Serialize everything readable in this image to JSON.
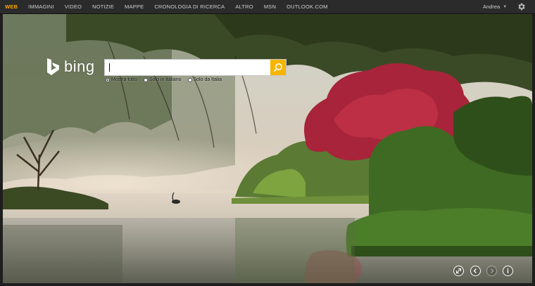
{
  "nav": {
    "items": [
      {
        "label": "WEB",
        "active": true
      },
      {
        "label": "IMMAGINI",
        "active": false
      },
      {
        "label": "VIDEO",
        "active": false
      },
      {
        "label": "NOTIZIE",
        "active": false
      },
      {
        "label": "MAPPE",
        "active": false
      },
      {
        "label": "CRONOLOGIA DI RICERCA",
        "active": false
      },
      {
        "label": "ALTRO",
        "active": false
      },
      {
        "label": "MSN",
        "active": false
      },
      {
        "label": "OUTLOOK.COM",
        "active": false
      }
    ],
    "user_name": "Andrea",
    "settings_icon": "gear-icon"
  },
  "colors": {
    "accent": "#f7a600",
    "topbar": "#2b2b2b",
    "search_button": "#f7b500"
  },
  "logo": {
    "text": "bing",
    "icon": "bing-b-icon"
  },
  "search": {
    "value": "",
    "placeholder": "",
    "button_icon": "search-icon"
  },
  "scopes": [
    {
      "label": "Mostra tutto",
      "checked": true
    },
    {
      "label": "Solo in italiano",
      "checked": false
    },
    {
      "label": "Solo da Italia",
      "checked": false
    }
  ],
  "controls": [
    {
      "icon": "fullscreen-icon",
      "enabled": true
    },
    {
      "icon": "previous-image-icon",
      "enabled": true
    },
    {
      "icon": "next-image-icon",
      "enabled": false
    },
    {
      "icon": "info-icon",
      "enabled": true
    }
  ]
}
